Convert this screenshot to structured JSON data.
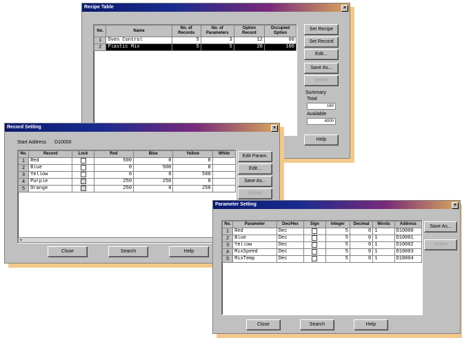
{
  "recipe_table": {
    "title": "Recipe Table",
    "columns": [
      "No.",
      "Name",
      "No. of Records",
      "No. of Parameters",
      "Option Record",
      "Occupied Option"
    ],
    "rows": [
      {
        "no": "1",
        "name": "Oven Control",
        "records": "5",
        "parameters": "3",
        "option": "12",
        "occupied": "60"
      },
      {
        "no": "2",
        "name": "Plastic Mix",
        "records": "5",
        "parameters": "5",
        "option": "20",
        "occupied": "100"
      }
    ],
    "buttons": {
      "set_recipe": "Set Recipe",
      "set_record": "Set Record",
      "edit": "Edit...",
      "save_as": "Save As...",
      "delete": "Delete",
      "help": "Help"
    },
    "summary": {
      "label": "Summary",
      "total_label": "Total",
      "total": "160",
      "available_label": "Available",
      "available": "4000"
    }
  },
  "record_setting": {
    "title": "Record Setting",
    "start_address_label": "Start Address",
    "start_address": "D10000",
    "columns": [
      "No.",
      "Record",
      "Lock",
      "Red",
      "Blue",
      "Yellow",
      "White"
    ],
    "rows": [
      {
        "no": "1",
        "record": "Red",
        "lock": false,
        "red": "500",
        "blue": "0",
        "yellow": "0"
      },
      {
        "no": "2",
        "record": "Blue",
        "lock": false,
        "red": "0",
        "blue": "500",
        "yellow": "0"
      },
      {
        "no": "3",
        "record": "Yellow",
        "lock": false,
        "red": "0",
        "blue": "0",
        "yellow": "500"
      },
      {
        "no": "4",
        "record": "Purple",
        "lock": true,
        "red": "250",
        "blue": "250",
        "yellow": "0"
      },
      {
        "no": "5",
        "record": "Orange",
        "lock": true,
        "red": "250",
        "blue": "0",
        "yellow": "250"
      }
    ],
    "buttons": {
      "edit_param": "Edit Param.",
      "edit": "Edit...",
      "save_as": "Save As...",
      "delete": "Delete",
      "close": "Close",
      "search": "Search",
      "help": "Help"
    }
  },
  "parameter_setting": {
    "title": "Parameter Setting",
    "columns": [
      "No.",
      "Parameter",
      "Dec/Hex",
      "Sign",
      "Integer",
      "Decimal",
      "Words",
      "Address"
    ],
    "rows": [
      {
        "no": "1",
        "parameter": "Red",
        "dechex": "Dec",
        "integer": "5",
        "decimal": "0",
        "words": "1",
        "address": "D10000"
      },
      {
        "no": "2",
        "parameter": "Blue",
        "dechex": "Dec",
        "integer": "5",
        "decimal": "0",
        "words": "1",
        "address": "D10001"
      },
      {
        "no": "3",
        "parameter": "Yellow",
        "dechex": "Dec",
        "integer": "5",
        "decimal": "0",
        "words": "1",
        "address": "D10002"
      },
      {
        "no": "4",
        "parameter": "MixSpeed",
        "dechex": "Dec",
        "integer": "5",
        "decimal": "0",
        "words": "1",
        "address": "D10003"
      },
      {
        "no": "5",
        "parameter": "MixTemp",
        "dechex": "Dec",
        "integer": "5",
        "decimal": "0",
        "words": "1",
        "address": "D10004"
      }
    ],
    "buttons": {
      "save_as": "Save As...",
      "delete": "Delete",
      "close": "Close",
      "search": "Search",
      "help": "Help"
    }
  },
  "colors": {
    "title_start": "#0a1a6e",
    "title_end": "#d9a85a",
    "shadow": "#f2c98a",
    "face": "#c0c0c0"
  }
}
